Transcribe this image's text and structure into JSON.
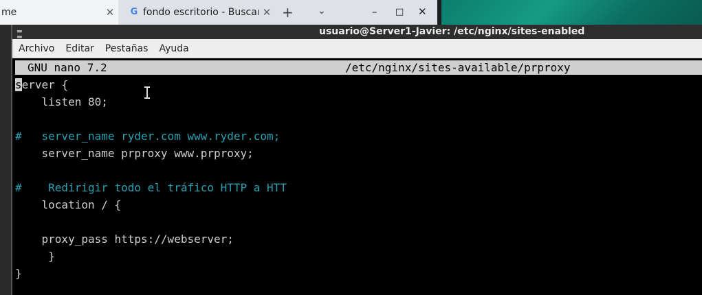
{
  "browser": {
    "tabs": [
      {
        "label": "me",
        "close_glyph": "✕"
      },
      {
        "label": "fondo escritorio - Buscar",
        "favicon": "G",
        "close_glyph": "✕"
      }
    ],
    "new_tab_glyph": "+",
    "tab_search_glyph": "⌄",
    "window_controls": {
      "minimize": "–",
      "maximize": "□",
      "close": "✕"
    }
  },
  "terminal": {
    "title": "usuario@Server1-Javier: /etc/nginx/sites-enabled",
    "menu": [
      "Archivo",
      "Editar",
      "Pestañas",
      "Ayuda"
    ],
    "nano": {
      "version": "GNU nano 7.2",
      "file": "/etc/nginx/sites-available/prproxy"
    },
    "lines": [
      {
        "cursor": "s",
        "text": "erver {",
        "comment": false
      },
      {
        "text": "    listen 80;",
        "comment": false
      },
      {
        "text": "",
        "comment": false
      },
      {
        "text": "#   server_name ryder.com www.ryder.com;",
        "comment": true
      },
      {
        "text": "    server_name prproxy www.prproxy;",
        "comment": false
      },
      {
        "text": "",
        "comment": false
      },
      {
        "text": "#    Redirigir todo el tráfico HTTP a HTT",
        "comment": true
      },
      {
        "text": "    location / {",
        "comment": false
      },
      {
        "text": "",
        "comment": false
      },
      {
        "text": "    proxy_pass https://webserver;",
        "comment": false
      },
      {
        "text": "     }",
        "comment": false
      },
      {
        "text": "}",
        "comment": false
      }
    ]
  },
  "colors": {
    "comment": "#2aa1b3",
    "terminal_bg": "#000000",
    "editor_text": "#d0d0d0",
    "header_bar": "#cfcfcf"
  }
}
